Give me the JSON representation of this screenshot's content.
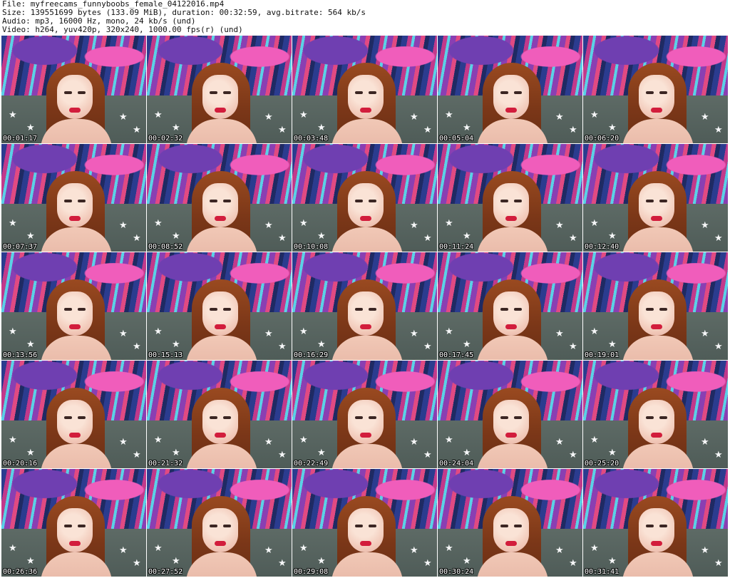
{
  "header": {
    "file": "File: myfreecams_funnyboobs_female_04122016.mp4",
    "size": "Size: 139551699 bytes (133.09 MiB), duration: 00:32:59, avg.bitrate: 564 kb/s",
    "audio": "Audio: mp3, 16000 Hz, mono, 24 kb/s (und)",
    "video": "Video: h264, yuv420p, 320x240, 1000.00 fps(r) (und)"
  },
  "thumbnails": [
    {
      "time": "00:01:17"
    },
    {
      "time": "00:02:32"
    },
    {
      "time": "00:03:48"
    },
    {
      "time": "00:05:04"
    },
    {
      "time": "00:06:20"
    },
    {
      "time": "00:07:37"
    },
    {
      "time": "00:08:52"
    },
    {
      "time": "00:10:08"
    },
    {
      "time": "00:11:24"
    },
    {
      "time": "00:12:40"
    },
    {
      "time": "00:13:56"
    },
    {
      "time": "00:15:13"
    },
    {
      "time": "00:16:29"
    },
    {
      "time": "00:17:45"
    },
    {
      "time": "00:19:01"
    },
    {
      "time": "00:20:16"
    },
    {
      "time": "00:21:32"
    },
    {
      "time": "00:22:49"
    },
    {
      "time": "00:24:04"
    },
    {
      "time": "00:25:20"
    },
    {
      "time": "00:26:36"
    },
    {
      "time": "00:27:52"
    },
    {
      "time": "00:29:08"
    },
    {
      "time": "00:30:24"
    },
    {
      "time": "00:31:41"
    }
  ]
}
